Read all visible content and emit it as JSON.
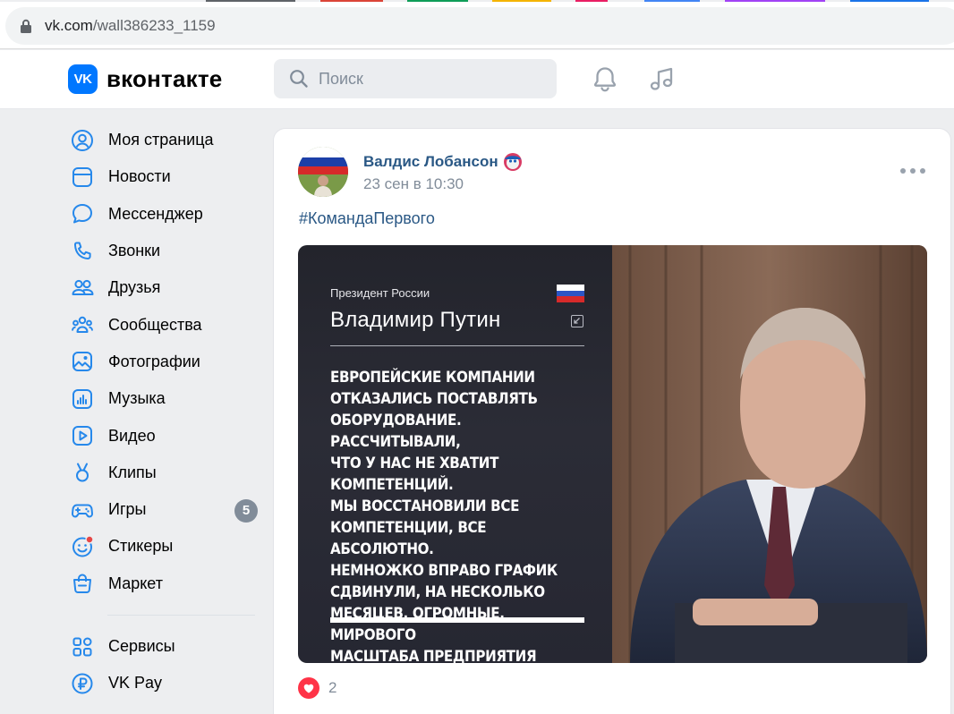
{
  "browser": {
    "url_prefix": "vk.com",
    "url_path": "/wall386233_1159"
  },
  "header": {
    "logo_mark": "VK",
    "logo_text": "вконтакте",
    "search_placeholder": "Поиск",
    "icons": [
      "bell-icon",
      "music-note-icon"
    ]
  },
  "sidebar": {
    "items": [
      {
        "label": "Моя страница",
        "icon": "user-circle-icon"
      },
      {
        "label": "Новости",
        "icon": "news-icon"
      },
      {
        "label": "Мессенджер",
        "icon": "message-bubble-icon"
      },
      {
        "label": "Звонки",
        "icon": "phone-icon"
      },
      {
        "label": "Друзья",
        "icon": "friends-icon"
      },
      {
        "label": "Сообщества",
        "icon": "communities-icon"
      },
      {
        "label": "Фотографии",
        "icon": "photo-icon"
      },
      {
        "label": "Музыка",
        "icon": "music-icon"
      },
      {
        "label": "Видео",
        "icon": "video-icon"
      },
      {
        "label": "Клипы",
        "icon": "clips-icon"
      },
      {
        "label": "Игры",
        "icon": "gamepad-icon",
        "badge": "5"
      },
      {
        "label": "Стикеры",
        "icon": "sticker-icon"
      },
      {
        "label": "Маркет",
        "icon": "market-bag-icon"
      }
    ],
    "secondary_items": [
      {
        "label": "Сервисы",
        "icon": "services-grid-icon"
      },
      {
        "label": "VK Pay",
        "icon": "vk-pay-icon"
      }
    ]
  },
  "post": {
    "author": "Валдис Лобансон",
    "date": "23 сен в 10:30",
    "hashtag": "#КомандаПервого",
    "image": {
      "subtitle": "Президент России",
      "name": "Владимир Путин",
      "quote": "ЕВРОПЕЙСКИЕ КОМПАНИИ\nОТКАЗАЛИСЬ ПОСТАВЛЯТЬ\nОБОРУДОВАНИЕ. РАССЧИТЫВАЛИ,\nЧТО У НАС НЕ ХВАТИТ КОМПЕТЕНЦИЙ.\nМЫ ВОССТАНОВИЛИ ВСЕ\nКОМПЕТЕНЦИИ, ВСЕ АБСОЛЮТНО.\nНЕМНОЖКО ВПРАВО ГРАФИК\nСДВИНУЛИ, НА НЕСКОЛЬКО\nМЕСЯЦЕВ. ОГРОМНЫЕ, МИРОВОГО\nМАСШТАБА ПРЕДПРИЯТИЯ БУДУТ\nВВЕДЕНЫ В БЛИЖАЙШЕЕ ВРЕМЯ"
    },
    "likes": "2"
  },
  "colors": {
    "vk_blue": "#0077ff",
    "link": "#2a5885",
    "secondary_text": "#818c99",
    "like_red": "#ff3347",
    "page_bg": "#edeef0"
  }
}
